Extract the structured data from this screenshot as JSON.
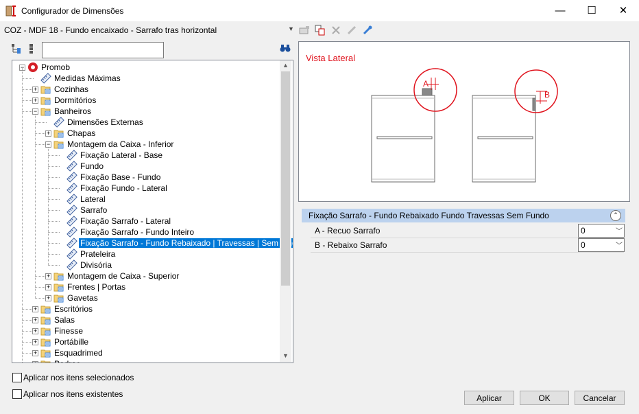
{
  "window": {
    "title": "Configurador de Dimensões",
    "minimize": "—",
    "maximize": "☐",
    "close": "✕"
  },
  "config": {
    "current": "COZ - MDF 18 - Fundo encaixado - Sarrafo tras horizontal",
    "dropdown_arrow": "▼"
  },
  "search": {
    "value": ""
  },
  "tree": [
    {
      "label": "Promob",
      "level": 0,
      "expander": "-",
      "icon": "promob-logo"
    },
    {
      "label": "Medidas Máximas",
      "level": 1,
      "expander": "",
      "icon": "ruler"
    },
    {
      "label": "Cozinhas",
      "level": 1,
      "expander": "+",
      "icon": "folder"
    },
    {
      "label": "Dormitórios",
      "level": 1,
      "expander": "+",
      "icon": "folder"
    },
    {
      "label": "Banheiros",
      "level": 1,
      "expander": "-",
      "icon": "folder"
    },
    {
      "label": "Dimensões Externas",
      "level": 2,
      "expander": "",
      "icon": "ruler"
    },
    {
      "label": "Chapas",
      "level": 2,
      "expander": "+",
      "icon": "folder"
    },
    {
      "label": "Montagem da Caixa - Inferior",
      "level": 2,
      "expander": "-",
      "icon": "folder"
    },
    {
      "label": "Fixação Lateral - Base",
      "level": 3,
      "expander": "",
      "icon": "ruler"
    },
    {
      "label": "Fundo",
      "level": 3,
      "expander": "",
      "icon": "ruler"
    },
    {
      "label": "Fixação Base - Fundo",
      "level": 3,
      "expander": "",
      "icon": "ruler"
    },
    {
      "label": "Fixação Fundo - Lateral",
      "level": 3,
      "expander": "",
      "icon": "ruler"
    },
    {
      "label": "Lateral",
      "level": 3,
      "expander": "",
      "icon": "ruler"
    },
    {
      "label": "Sarrafo",
      "level": 3,
      "expander": "",
      "icon": "ruler"
    },
    {
      "label": "Fixação Sarrafo - Lateral",
      "level": 3,
      "expander": "",
      "icon": "ruler"
    },
    {
      "label": "Fixação Sarrafo - Fundo Inteiro",
      "level": 3,
      "expander": "",
      "icon": "ruler"
    },
    {
      "label": "Fixação Sarrafo - Fundo Rebaixado | Travessas | Sem fundo",
      "level": 3,
      "expander": "",
      "icon": "ruler",
      "selected": true
    },
    {
      "label": "Prateleira",
      "level": 3,
      "expander": "",
      "icon": "ruler"
    },
    {
      "label": "Divisória",
      "level": 3,
      "expander": "",
      "icon": "ruler"
    },
    {
      "label": "Montagem de Caixa - Superior",
      "level": 2,
      "expander": "+",
      "icon": "folder"
    },
    {
      "label": "Frentes | Portas",
      "level": 2,
      "expander": "+",
      "icon": "folder"
    },
    {
      "label": "Gavetas",
      "level": 2,
      "expander": "+",
      "icon": "folder"
    },
    {
      "label": "Escritórios",
      "level": 1,
      "expander": "+",
      "icon": "folder"
    },
    {
      "label": "Salas",
      "level": 1,
      "expander": "+",
      "icon": "folder"
    },
    {
      "label": "Finesse",
      "level": 1,
      "expander": "+",
      "icon": "folder"
    },
    {
      "label": "Portábille",
      "level": 1,
      "expander": "+",
      "icon": "folder"
    },
    {
      "label": "Esquadrimed",
      "level": 1,
      "expander": "+",
      "icon": "folder"
    },
    {
      "label": "Padrao",
      "level": 1,
      "expander": "+",
      "icon": "folder"
    }
  ],
  "preview": {
    "title": "Vista Lateral",
    "marker_a": "A",
    "marker_b": "B",
    "accent": "#e0141e"
  },
  "properties": {
    "group_title": "Fixação Sarrafo - Fundo Rebaixado  Fundo Travessas  Sem Fundo",
    "rows": [
      {
        "name": "A - Recuo Sarrafo",
        "value": "0"
      },
      {
        "name": "B - Rebaixo Sarrafo",
        "value": "0"
      }
    ]
  },
  "options": {
    "apply_selected": "Aplicar nos itens selecionados",
    "apply_existing": "Aplicar nos itens existentes"
  },
  "buttons": {
    "apply": "Aplicar",
    "ok": "OK",
    "cancel": "Cancelar"
  },
  "colors": {
    "selection": "#0078d7",
    "group_header": "#bcd2ee"
  }
}
